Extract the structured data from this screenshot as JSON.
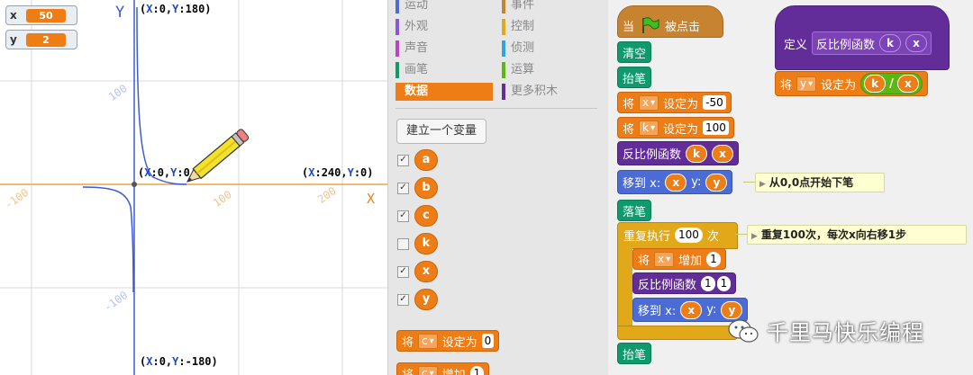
{
  "stage": {
    "monitors": [
      {
        "name": "x",
        "value": "50"
      },
      {
        "name": "y",
        "value": "2"
      }
    ],
    "axis_letters": {
      "y": "Y",
      "x": "X"
    },
    "coord_labels": {
      "top": {
        "open": "(",
        "xk": "X",
        "xv": ":0,",
        "yk": "Y",
        "yv": ":180",
        "close": ")"
      },
      "origin": {
        "open": "(",
        "xk": "X",
        "xv": ":0,",
        "yk": "Y",
        "yv": ":0",
        "close": ")"
      },
      "right": {
        "open": "(",
        "xk": "X",
        "xv": ":240,",
        "yk": "Y",
        "yv": ":0",
        "close": ")"
      },
      "bottom": {
        "open": "(",
        "xk": "X",
        "xv": ":0,",
        "yk": "Y",
        "yv": ":-180",
        "close": ")"
      }
    },
    "tick_labels": {
      "x_neg": "-100",
      "x_100": "100",
      "x_200": "200",
      "y_100": "100",
      "y_neg": "-100"
    }
  },
  "palette": {
    "categories": [
      {
        "label": "运动",
        "color": "#4a6cd4"
      },
      {
        "label": "事件",
        "color": "#c88330"
      },
      {
        "label": "外观",
        "color": "#8a55d7"
      },
      {
        "label": "控制",
        "color": "#e1a91a"
      },
      {
        "label": "声音",
        "color": "#bb42c3"
      },
      {
        "label": "侦测",
        "color": "#2ca5e2"
      },
      {
        "label": "画笔",
        "color": "#0e9a6c"
      },
      {
        "label": "运算",
        "color": "#5cb712"
      },
      {
        "label": "数据",
        "color": "#ee7d16"
      },
      {
        "label": "更多积木",
        "color": "#632d99"
      }
    ],
    "make_variable": "建立一个变量",
    "variables": [
      {
        "name": "a",
        "checked": true
      },
      {
        "name": "b",
        "checked": true
      },
      {
        "name": "c",
        "checked": true
      },
      {
        "name": "k",
        "checked": false
      },
      {
        "name": "x",
        "checked": true
      },
      {
        "name": "y",
        "checked": true
      }
    ],
    "set_block": {
      "prefix": "将",
      "var": "c",
      "mid": "设定为",
      "value": "0"
    },
    "change_block": {
      "prefix": "将",
      "var": "c",
      "mid": "增加",
      "value": "1"
    }
  },
  "script": {
    "hat": {
      "when": "当",
      "clicked": "被点击"
    },
    "clear": "清空",
    "pen_up": "抬笔",
    "set_x": {
      "prefix": "将",
      "var": "x",
      "mid": "设定为",
      "value": "-50"
    },
    "set_k": {
      "prefix": "将",
      "var": "k",
      "mid": "设定为",
      "value": "100"
    },
    "call1": {
      "name": "反比例函数",
      "a": "k",
      "b": "x"
    },
    "goto1": {
      "label": "移到 x:",
      "x": "x",
      "ylabel": "y:",
      "y": "y"
    },
    "comment1": "从0,0点开始下笔",
    "pen_down": "落笔",
    "repeat": {
      "label": "重复执行",
      "count": "100",
      "suffix": "次"
    },
    "comment2": "重复100次，每次x向右移1步",
    "change_x": {
      "prefix": "将",
      "var": "x",
      "mid": "增加",
      "value": "1"
    },
    "call2": {
      "name": "反比例函数",
      "a": "1",
      "b": "1"
    },
    "goto2": {
      "label": "移到 x:",
      "x": "x",
      "ylabel": "y:",
      "y": "y"
    },
    "pen_up2": "抬笔",
    "define": {
      "label": "定义",
      "name": "反比例函数",
      "a": "k",
      "b": "x"
    },
    "set_y": {
      "prefix": "将",
      "var": "y",
      "mid": "设定为",
      "left": "k",
      "op": "/",
      "right": "x"
    }
  },
  "watermark": "千里马快乐编程",
  "colors": {
    "data": "#ee7d16",
    "motion": "#4a6cd4",
    "pen": "#0e9a6c",
    "more": "#632d99",
    "control": "#e1a91a",
    "operators": "#5cb712"
  }
}
